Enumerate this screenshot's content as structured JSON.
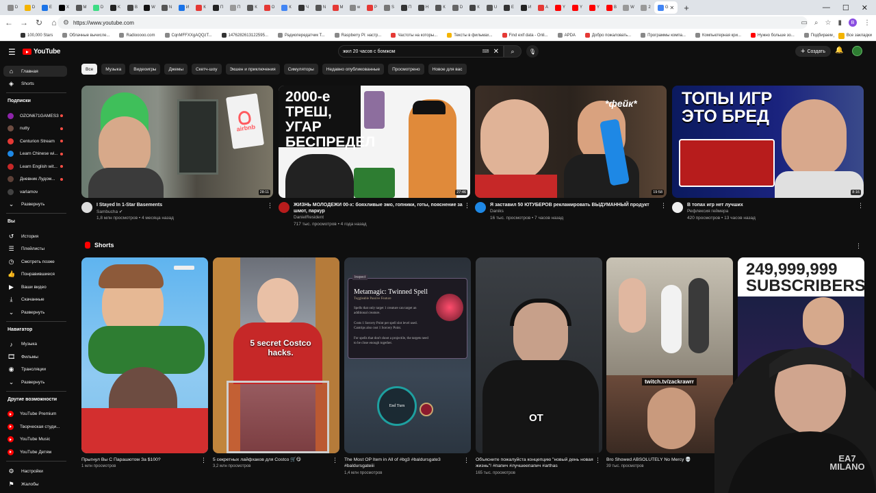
{
  "browser": {
    "url": "https://www.youtube.com",
    "tabs": [
      {
        "label": "D",
        "color": "#8a8a8a"
      },
      {
        "label": "D",
        "color": "#f4b400"
      },
      {
        "label": "E",
        "color": "#1a73e8"
      },
      {
        "label": "X",
        "color": "#000000"
      },
      {
        "label": "M",
        "color": "#555555"
      },
      {
        "label": "D",
        "color": "#3ddc84"
      },
      {
        "label": "K",
        "color": "#222222"
      },
      {
        "label": "B",
        "color": "#444444"
      },
      {
        "label": "W",
        "color": "#111111"
      },
      {
        "label": "N",
        "color": "#555555"
      },
      {
        "label": "И",
        "color": "#1a73e8"
      },
      {
        "label": "К",
        "color": "#e53935"
      },
      {
        "label": "П",
        "color": "#222222"
      },
      {
        "label": "П",
        "color": "#999999"
      },
      {
        "label": "К",
        "color": "#555555"
      },
      {
        "label": "О",
        "color": "#e53935"
      },
      {
        "label": "К",
        "color": "#4285f4"
      },
      {
        "label": "Ч",
        "color": "#333333"
      },
      {
        "label": "N",
        "color": "#555555"
      },
      {
        "label": "М",
        "color": "#e53935"
      },
      {
        "label": "w",
        "color": "#888888"
      },
      {
        "label": "Р",
        "color": "#e53935"
      },
      {
        "label": "S",
        "color": "#777777"
      },
      {
        "label": "П",
        "color": "#333333"
      },
      {
        "label": "H",
        "color": "#444444"
      },
      {
        "label": "К",
        "color": "#555555"
      },
      {
        "label": "D",
        "color": "#666666"
      },
      {
        "label": "К",
        "color": "#444444"
      },
      {
        "label": "U",
        "color": "#555555"
      },
      {
        "label": "Е",
        "color": "#333333"
      },
      {
        "label": "И",
        "color": "#222222"
      },
      {
        "label": "А",
        "color": "#e53935"
      },
      {
        "label": "Y",
        "color": "#ff0000"
      },
      {
        "label": "Y",
        "color": "#ff0000"
      },
      {
        "label": "Y",
        "color": "#ff0000"
      },
      {
        "label": "B",
        "color": "#ff0000"
      },
      {
        "label": "W",
        "color": "#999999"
      },
      {
        "label": "2",
        "color": "#999999"
      },
      {
        "label": "G",
        "color": "#4285f4"
      }
    ],
    "active_tab_label": "Y",
    "bookmarks": [
      {
        "label": "100,000 Stars",
        "color": "#333333"
      },
      {
        "label": "Облачные вычисле...",
        "color": "#888888"
      },
      {
        "label": "Radiooooo.com",
        "color": "#888888"
      },
      {
        "label": "CqnMFFXXgAQQzT...",
        "color": "#888888"
      },
      {
        "label": "1476282613122595...",
        "color": "#333333"
      },
      {
        "label": "Радиопередатчик Т...",
        "color": "#888888"
      },
      {
        "label": "Raspberry Pi: настр...",
        "color": "#888888"
      },
      {
        "label": "Частоты на которы...",
        "color": "#e53935"
      },
      {
        "label": "Тексты в фильмах...",
        "color": "#f4b400"
      },
      {
        "label": "Find exif data - Onli...",
        "color": "#e53935"
      },
      {
        "label": "APDA",
        "color": "#888888"
      },
      {
        "label": "Добро пожаловать...",
        "color": "#e53935"
      },
      {
        "label": "Программы компа...",
        "color": "#888888"
      },
      {
        "label": "Компьютерная кри...",
        "color": "#888888"
      },
      {
        "label": "Нужно больше зо...",
        "color": "#ff0000"
      },
      {
        "label": "Подбираем дизайн...",
        "color": "#888888"
      }
    ],
    "bookmarks_all": "Все закладки"
  },
  "header": {
    "logo": "YouTube",
    "search_value": "жил 20 часов с бомжом",
    "create_label": "Создать"
  },
  "sidebar": {
    "main": [
      {
        "label": "Главная",
        "icon": "home-icon"
      },
      {
        "label": "Shorts",
        "icon": "shorts-icon"
      }
    ],
    "subs_title": "Подписки",
    "subs": [
      {
        "label": "OZON671GAMES3",
        "color": "#8e24aa",
        "live": true
      },
      {
        "label": "nutty",
        "color": "#6d4c41",
        "live": true
      },
      {
        "label": "Centurion Stream",
        "color": "#e53935",
        "live": true
      },
      {
        "label": "Learn Chinese wi...",
        "color": "#1e88e5",
        "live": true
      },
      {
        "label": "Learn English wit...",
        "color": "#c62828",
        "live": true
      },
      {
        "label": "Дневник Лудом...",
        "color": "#5d4037",
        "live": true
      },
      {
        "label": "varlamov",
        "color": "#424242",
        "live": false
      }
    ],
    "subs_expand": "Развернуть",
    "you_title": "Вы",
    "you": [
      {
        "label": "История",
        "icon": "history-icon"
      },
      {
        "label": "Плейлисты",
        "icon": "playlist-icon"
      },
      {
        "label": "Смотреть позже",
        "icon": "clock-icon"
      },
      {
        "label": "Понравившиеся",
        "icon": "like-icon"
      },
      {
        "label": "Ваши видео",
        "icon": "video-icon"
      },
      {
        "label": "Скачанные",
        "icon": "download-icon"
      },
      {
        "label": "Развернуть",
        "icon": "chevron-down-icon"
      }
    ],
    "nav_title": "Навигатор",
    "nav": [
      {
        "label": "Музыка",
        "icon": "music-icon"
      },
      {
        "label": "Фильмы",
        "icon": "film-icon"
      },
      {
        "label": "Трансляции",
        "icon": "live-icon"
      },
      {
        "label": "Развернуть",
        "icon": "chevron-down-icon"
      }
    ],
    "more_title": "Другие возможности",
    "more": [
      {
        "label": "YouTube Premium"
      },
      {
        "label": "Творческая студи..."
      },
      {
        "label": "YouTube Music"
      },
      {
        "label": "YouTube Детям"
      }
    ],
    "bottom": [
      {
        "label": "Настройки",
        "icon": "gear-icon"
      },
      {
        "label": "Жалобы",
        "icon": "flag-icon"
      }
    ]
  },
  "chips": [
    "Все",
    "Музыка",
    "Видеоигры",
    "Джемы",
    "Скетч-шоу",
    "Экшен и приключения",
    "Симуляторы",
    "Недавно опубликованные",
    "Просмотрено",
    "Новое для вас"
  ],
  "videos": [
    {
      "title": "I Stayed In 1-Star Basements",
      "channel": "Sambucha ✔",
      "stats": "1,8 млн просмотров • 4 месяца назад",
      "duration": "28:11",
      "thumb_text": "airbnb",
      "avatar_color": "#dddddd"
    },
    {
      "title": "ЖИЗНЬ МОЛОДЕЖИ 00-х: бояхливые эмо, гопники, готы, пояснение за шмот, паркур",
      "channel": "DanielResident",
      "stats": "717 тыс. просмотров • 4 года назад",
      "duration": "27:46",
      "thumb_text": "2000-е ТРЕШ, УГАР БЕСПРЕДЕЛ",
      "avatar_color": "#b71c1c"
    },
    {
      "title": "Я заставил 50 ЮТУБЕРОВ рекламировать ВЫДУМАННЫЙ продукт",
      "channel": "Daniks",
      "stats": "16 тыс. просмотров • 7 часов назад",
      "duration": "19:58",
      "thumb_text": "*фейк*",
      "avatar_color": "#1e88e5"
    },
    {
      "title": "В топах игр нет лучших",
      "channel": "Рефлексия геймера",
      "stats": "420 просмотров • 13 часов назад",
      "duration": "8:16",
      "thumb_text": "ТОПЫ ИГР ЭТО БРЕД",
      "avatar_color": "#eeeeee"
    }
  ],
  "shorts_title": "Shorts",
  "shorts": [
    {
      "title": "Прыгнул Вы С Парашютом За $100?",
      "views": "1 млн просмотров",
      "overlay": ""
    },
    {
      "title": "5 секретных лайфхаков для Costco 🛒😋",
      "views": "3,2 млн просмотров",
      "overlay": "5 secret Costco hacks."
    },
    {
      "title": "The Most OP Item in All of #bg3 #baldursgate3 #baldursgateiii",
      "views": "1,4 млн просмотров",
      "overlay": "Metamagic: Twinned Spell"
    },
    {
      "title": "Объясните пожалуйста концепцию \"новый день новая жизнь\"! #папич #лучшеепапич #arthas",
      "views": "165 тыс. просмотров",
      "overlay": "ОТ"
    },
    {
      "title": "Bro Showed ABSOLUTELY No Mercy 💀",
      "views": "39 тыс. просмотров",
      "overlay": "twitch.tv/zackrawrr"
    },
    {
      "title": "",
      "views": "",
      "overlay": "249,999,999 SUBSCRIBERS"
    }
  ],
  "card_detail": {
    "spell_sub": "Toggleable Passive Feature",
    "spell_body": "Spells that only target 1 creature can target an additional creature.",
    "spell_cost": "Costs 1 Sorcery Point per spell slot level used. Cantrips also cost 1 Sorcery Point.",
    "spell_note": "For spells that don't shoot a projectile, the targets need to be close enough together.",
    "end_turn": "End Turn",
    "inspect": "Inspect"
  },
  "webcam_text": "EA7 MILANO"
}
